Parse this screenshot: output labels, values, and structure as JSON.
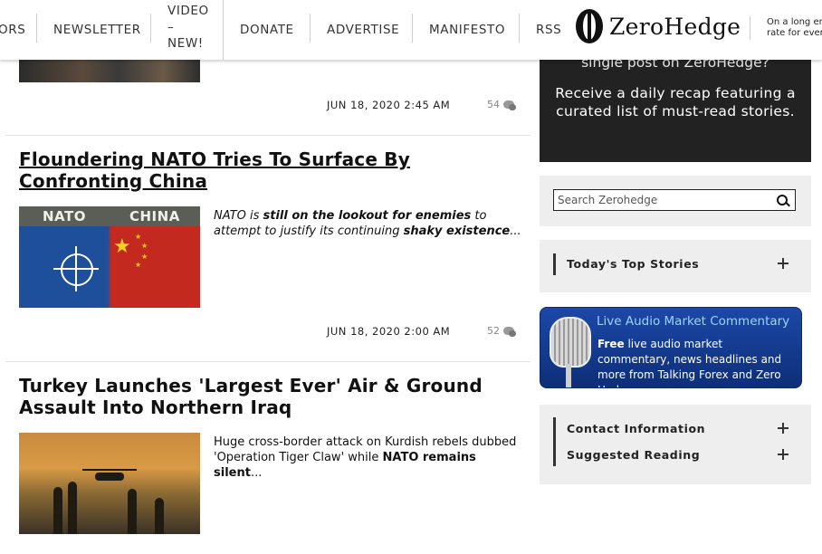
{
  "nav": {
    "items": [
      "ORS",
      "NEWSLETTER",
      "DONATE",
      "ADVERTISE",
      "MANIFESTO",
      "RSS"
    ],
    "video_lines": [
      "VIDEO",
      "–",
      "NEW!"
    ],
    "logo_text": "ZeroHedge",
    "tagline_lines": [
      "On a long en",
      "rate for ever"
    ]
  },
  "articles": [
    {
      "meta": "JUN 18, 2020 2:45 AM",
      "comments": "54"
    },
    {
      "title": "Floundering NATO Tries To Surface By Confronting China",
      "image_labels": [
        "NATO",
        "CHINA"
      ],
      "summary_parts": [
        {
          "text": "NATO is ",
          "bold": false
        },
        {
          "text": "still on the lookout for enemies",
          "bold": true
        },
        {
          "text": " to attempt to justify its continuing ",
          "bold": false
        },
        {
          "text": "shaky existence",
          "bold": true
        },
        {
          "text": "...",
          "bold": false
        }
      ],
      "meta": "JUN 18, 2020 2:00 AM",
      "comments": "52"
    },
    {
      "title": "Turkey Launches 'Largest Ever' Air & Ground Assault Into Northern Iraq",
      "summary_parts": [
        {
          "text": "Huge cross-border attack on Kurdish rebels dubbed 'Operation Tiger Claw' while ",
          "bold": false
        },
        {
          "text": "NATO remains silent",
          "bold": true
        },
        {
          "text": "...",
          "bold": false
        }
      ]
    }
  ],
  "sidebar": {
    "recap_cut": "single post on ZeroHedge?",
    "recap_text": "Receive a daily recap featuring a curated list of must-read stories.",
    "search_placeholder": "Search Zerohedge",
    "top_stories": "Today's Top Stories",
    "audio": {
      "title": "Live Audio Market Commentary",
      "free": "Free",
      "body": " live audio market commentary, news headlines and more from Talking Forex and Zero Hedge"
    },
    "contact": "Contact Information",
    "suggested": "Suggested Reading"
  },
  "colors": {
    "recap_bg": "#222222",
    "panel_bg": "#eeeeee",
    "audio_bg": "#1c48a8",
    "audio_title": "#9fd3ff"
  }
}
